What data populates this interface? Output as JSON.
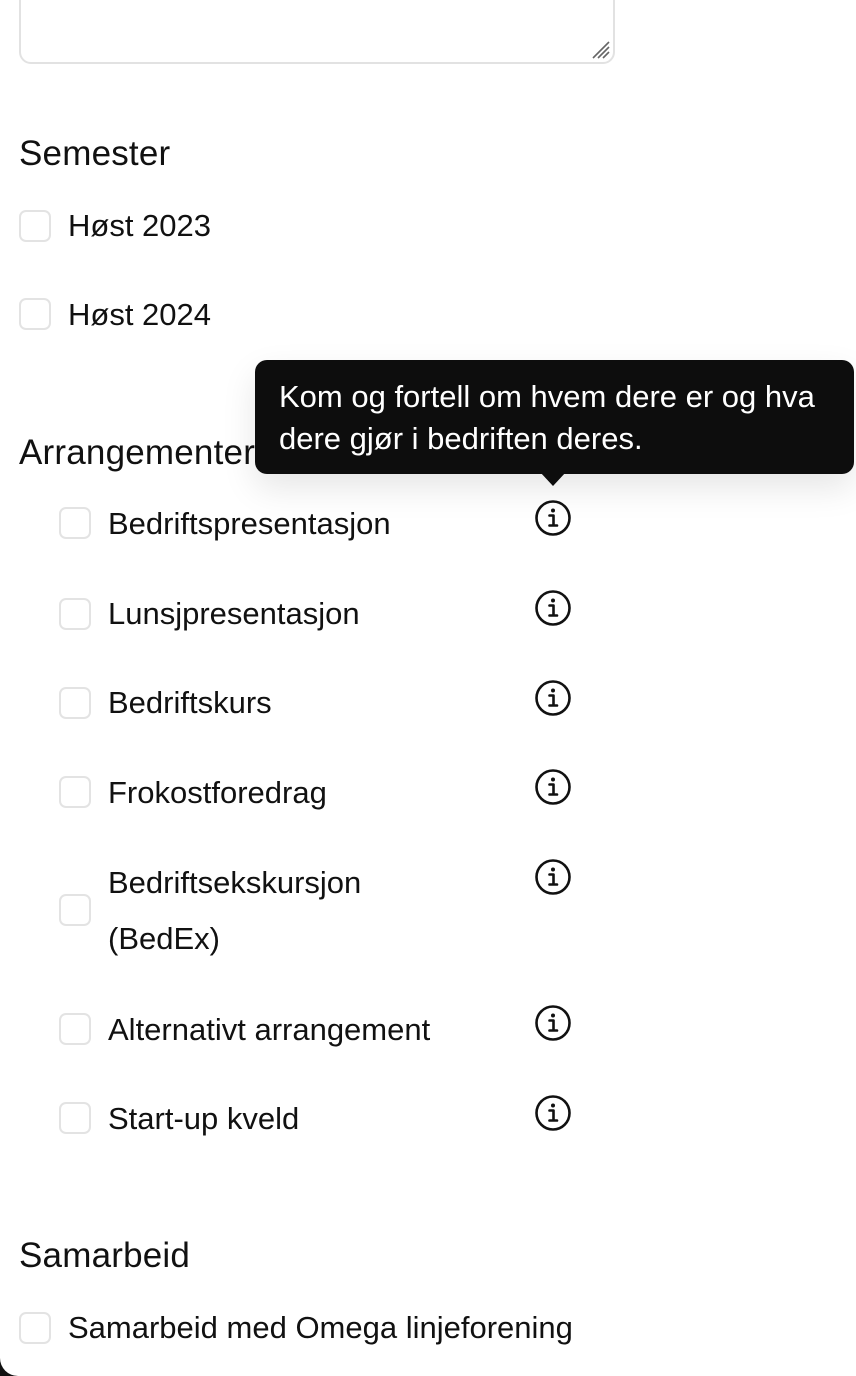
{
  "semester": {
    "title": "Semester",
    "options": [
      {
        "label": "Høst 2023",
        "checked": false
      },
      {
        "label": "Høst 2024",
        "checked": false
      }
    ]
  },
  "arrangementer": {
    "title": "Arrangementer",
    "options": [
      {
        "label": "Bedriftspresentasjon",
        "checked": false
      },
      {
        "label": "Lunsjpresentasjon",
        "checked": false
      },
      {
        "label": "Bedriftskurs",
        "checked": false
      },
      {
        "label": "Frokostforedrag",
        "checked": false
      },
      {
        "label": "Bedriftsekskursjon (BedEx)",
        "checked": false
      },
      {
        "label": "Alternativt arrangement",
        "checked": false
      },
      {
        "label": "Start-up kveld",
        "checked": false
      }
    ],
    "info_icon": "info-circle-icon"
  },
  "tooltip": {
    "text": "Kom og fortell om hvem dere er og hva dere gjør i bedriften deres."
  },
  "samarbeid": {
    "title": "Samarbeid",
    "options": [
      {
        "label": "Samarbeid med Omega linjeforening",
        "checked": false
      }
    ]
  },
  "colors": {
    "tooltip_bg": "#0d0d0d",
    "checkbox_border": "#e3e3e3",
    "text": "#111111"
  }
}
